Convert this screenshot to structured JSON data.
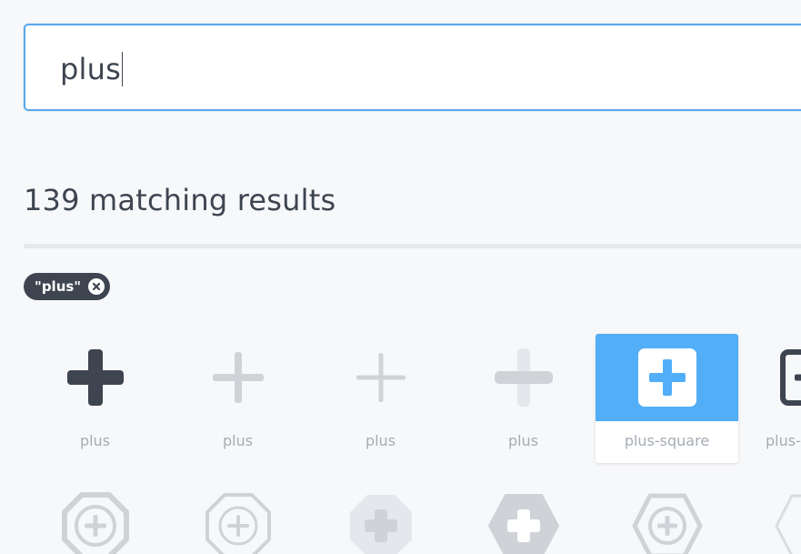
{
  "search": {
    "value": "plus"
  },
  "results": {
    "heading": "139 matching results"
  },
  "filter_tag": {
    "label": "\"plus\""
  },
  "icons_row1": [
    {
      "label": "plus",
      "icon": "plus-icon-solid-dark"
    },
    {
      "label": "plus",
      "icon": "plus-icon-regular-light"
    },
    {
      "label": "plus",
      "icon": "plus-icon-light"
    },
    {
      "label": "plus",
      "icon": "plus-icon-duotone"
    },
    {
      "label": "plus-square",
      "icon": "plus-square-icon",
      "selected": true
    },
    {
      "label": "plus-",
      "icon": "plus-square-outline-icon"
    }
  ],
  "icons_row2": [
    {
      "icon": "plus-octagon-outline-icon"
    },
    {
      "icon": "plus-octagon-outline-icon"
    },
    {
      "icon": "plus-octagon-solid-light-icon"
    },
    {
      "icon": "plus-hexagon-solid-icon"
    },
    {
      "icon": "plus-hexagon-outline-icon"
    },
    {
      "icon": "plus-hexagon-outline-icon"
    }
  ],
  "colors": {
    "accent": "#52aef7",
    "focus_border": "#5aa7ea",
    "text_dark": "#3e4551",
    "text_muted": "#a6acb4",
    "icon_light": "#cfd3d8",
    "background": "#f7f8fa"
  }
}
